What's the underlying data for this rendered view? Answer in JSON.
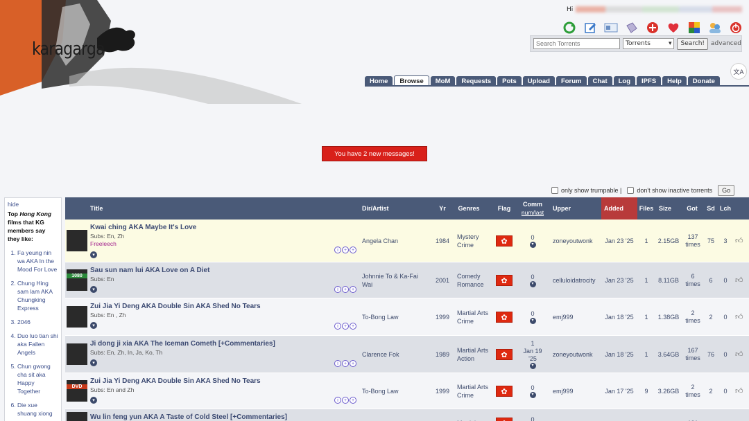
{
  "logo": {
    "text": "karagarga"
  },
  "greeting": {
    "prefix": "Hi"
  },
  "top_icons": [
    "refresh-icon",
    "edit-icon",
    "id-card-icon",
    "tag-icon",
    "plus-circle-icon",
    "heart-icon",
    "puzzle-icon",
    "users-icon",
    "power-icon"
  ],
  "search": {
    "placeholder": "Search Torrents",
    "category": "Torrents",
    "button": "Search!",
    "advanced": "advanced"
  },
  "nav": {
    "tabs": [
      "Home",
      "Browse",
      "MoM",
      "Requests",
      "Pots",
      "Upload",
      "Forum",
      "Chat",
      "Log",
      "IPFS",
      "Help",
      "Donate"
    ],
    "active": "Browse"
  },
  "message": "You have 2 new messages!",
  "filters": {
    "trumpable": "only show trumpable |",
    "inactive": "don't show inactive torrents",
    "go": "Go"
  },
  "sidebar": {
    "hide": "hide",
    "heading_pre": "Top ",
    "heading_em": "Hong Kong",
    "heading_post": " films that KG members say they like:",
    "items": [
      "Fa yeung nin wa AKA In the Mood For Love",
      "Chung Hing sam lam AKA Chungking Express",
      "2046",
      "Duo luo tian shi aka Fallen Angels",
      "Chun gwong cha sit aka Happy Together",
      "Die xue shuang xiong"
    ]
  },
  "table": {
    "headers": {
      "title": "Title",
      "dir": "Dir/Artist",
      "yr": "Yr",
      "genres": "Genres",
      "flag": "Flag",
      "comm": "Comm",
      "comm_sub1": "num",
      "comm_sep": "/",
      "comm_sub2": "last",
      "upper": "Upper",
      "added": "Added",
      "files": "Files",
      "size": "Size",
      "got": "Got",
      "sd": "Sd",
      "lch": "Lch"
    },
    "rows": [
      {
        "title": "Kwai ching AKA Maybe It's Love",
        "subs": "Subs: En, Zh",
        "free": "Freeleech",
        "dir": "Angela Chan",
        "yr": "1984",
        "genres": "Mystery Crime",
        "comm": "0",
        "comm_extra": "",
        "upper": "zoneyoutwonk",
        "added": "Jan 23 '25",
        "files": "1",
        "size": "2.15GB",
        "got": "137 times",
        "sd": "75",
        "lch": "3",
        "thumb_label": ""
      },
      {
        "title": "Sau sun nam lui AKA Love on A Diet",
        "subs": "Subs: En",
        "free": "",
        "dir": "Johnnie To & Ka-Fai Wai",
        "yr": "2001",
        "genres": "Comedy Romance",
        "comm": "0",
        "comm_extra": "",
        "upper": "celluloidatrocity",
        "added": "Jan 23 '25",
        "files": "1",
        "size": "8.11GB",
        "got": "6 times",
        "sd": "6",
        "lch": "0",
        "thumb_label": "1080"
      },
      {
        "title": "Zui Jia Yi Deng AKA Double Sin AKA Shed No Tears",
        "subs": "Subs: En , Zh",
        "free": "",
        "dir": "To-Bong Law",
        "yr": "1999",
        "genres": "Martial Arts Crime",
        "comm": "0",
        "comm_extra": "",
        "upper": "emj999",
        "added": "Jan 18 '25",
        "files": "1",
        "size": "1.38GB",
        "got": "2 times",
        "sd": "2",
        "lch": "0",
        "thumb_label": ""
      },
      {
        "title": "Ji dong ji xia AKA The Iceman Cometh [+Commentaries]",
        "subs": "Subs: En, Zh, In, Ja, Ko, Th",
        "free": "",
        "dir": "Clarence Fok",
        "yr": "1989",
        "genres": "Martial Arts Action",
        "comm": "1",
        "comm_extra": "Jan 19 '25",
        "upper": "zoneyoutwonk",
        "added": "Jan 18 '25",
        "files": "1",
        "size": "3.64GB",
        "got": "167 times",
        "sd": "76",
        "lch": "0",
        "thumb_label": ""
      },
      {
        "title": "Zui Jia Yi Deng AKA Double Sin AKA Shed No Tears",
        "subs": "Subs: En and Zh",
        "free": "",
        "dir": "To-Bong Law",
        "yr": "1999",
        "genres": "Martial Arts Crime",
        "comm": "0",
        "comm_extra": "",
        "upper": "emj999",
        "added": "Jan 17 '25",
        "files": "9",
        "size": "3.26GB",
        "got": "2 times",
        "sd": "2",
        "lch": "0",
        "thumb_label": "DVD"
      },
      {
        "title": "Wu lin feng yun AKA A Taste of Cold Steel [+Commentaries]",
        "subs": "",
        "free": "",
        "dir": "",
        "yr": "",
        "genres": "Martial",
        "comm": "0",
        "comm_extra": "",
        "upper": "",
        "added": "",
        "files": "",
        "size": "",
        "got": "181",
        "sd": "",
        "lch": "",
        "thumb_label": ""
      }
    ]
  },
  "colors": {
    "header_bg": "#4a5a78",
    "added_col": "#b83a3a",
    "row_highlight": "#fcfbe3",
    "row_odd": "#dde0e6",
    "row_even": "#f4f5f8",
    "message_bg": "#d8201a"
  }
}
